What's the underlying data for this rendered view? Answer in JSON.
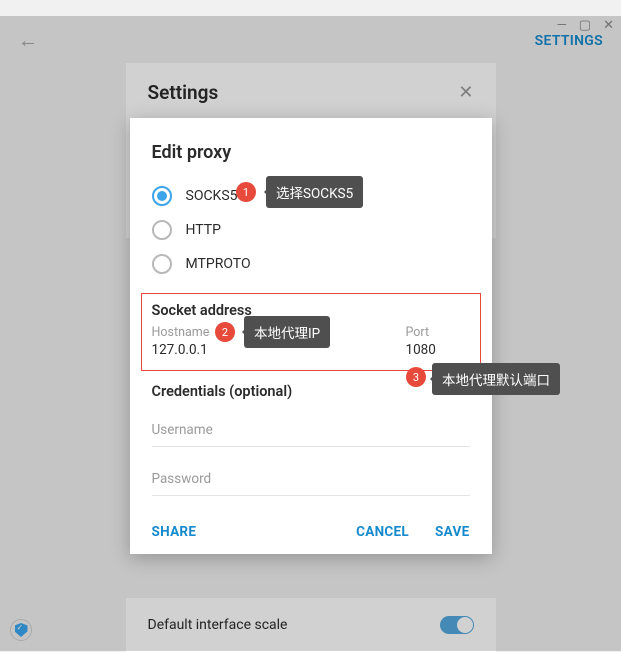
{
  "window": {
    "min": "—",
    "max": "▢",
    "close": "✕"
  },
  "topbar": {
    "settings": "SETTINGS"
  },
  "panel": {
    "title": "Settings"
  },
  "setting_below": {
    "label": "Default interface scale"
  },
  "modal": {
    "title": "Edit proxy",
    "radios": {
      "socks5": "SOCKS5",
      "http": "HTTP",
      "mtproto": "MTPROTO"
    },
    "socket": {
      "title": "Socket address",
      "host_label": "Hostname",
      "host_value": "127.0.0.1",
      "port_label": "Port",
      "port_value": "1080"
    },
    "creds": {
      "title": "Credentials (optional)",
      "user_ph": "Username",
      "pass_ph": "Password"
    },
    "actions": {
      "share": "SHARE",
      "cancel": "CANCEL",
      "save": "SAVE"
    }
  },
  "annot": {
    "b1": "1",
    "t1": "选择SOCKS5",
    "b2": "2",
    "t2": "本地代理IP",
    "b3": "3",
    "t3": "本地代理默认端口"
  }
}
